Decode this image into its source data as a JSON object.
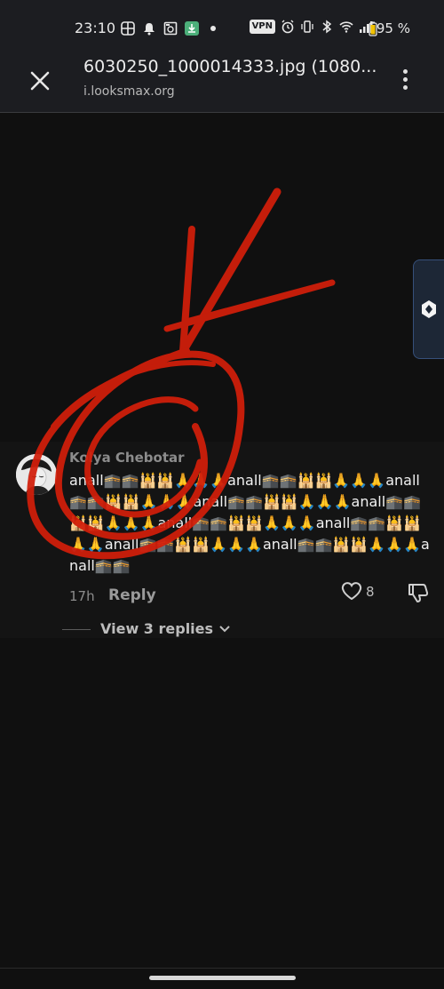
{
  "status_bar": {
    "time": "23:10",
    "vpn": "VPN",
    "battery": "95 %",
    "icons": [
      "grid-icon",
      "bell-icon",
      "screenshot-icon",
      "download-icon",
      "dot-icon",
      "vpn-icon",
      "alarm-icon",
      "vibrate-icon",
      "bluetooth-icon",
      "wifi-icon",
      "signal-icon",
      "battery-icon"
    ]
  },
  "toolbar": {
    "title": "6030250_1000014333.jpg (1080...",
    "url": "i.looksmax.org"
  },
  "comment": {
    "author": "Kolya Chebotar",
    "text": "anall🕋🕋🕌🕌🙏🙏🙏anall🕋🕋🕌🕌🙏🙏🙏anall🕋🕋🕌🕌🙏🙏🙏anall🕋🕋🕌🕌🙏🙏🙏anall🕋🕋🕌🕌🙏🙏🙏anall🕋🕋🕌🕌🙏🙏🙏anall🕋🕋🕌🕌🙏🙏anall🕋🕋🕌🕌🙏🙏🙏anall🕋🕋🕌🕌🙏🙏🙏anall🕋🕋",
    "time": "17h",
    "reply_label": "Reply",
    "likes": "8",
    "view_replies": "View 3 replies"
  },
  "colors": {
    "background": "#101010",
    "toolbar": "#1c1d21",
    "scribble": "#d21e0a"
  }
}
